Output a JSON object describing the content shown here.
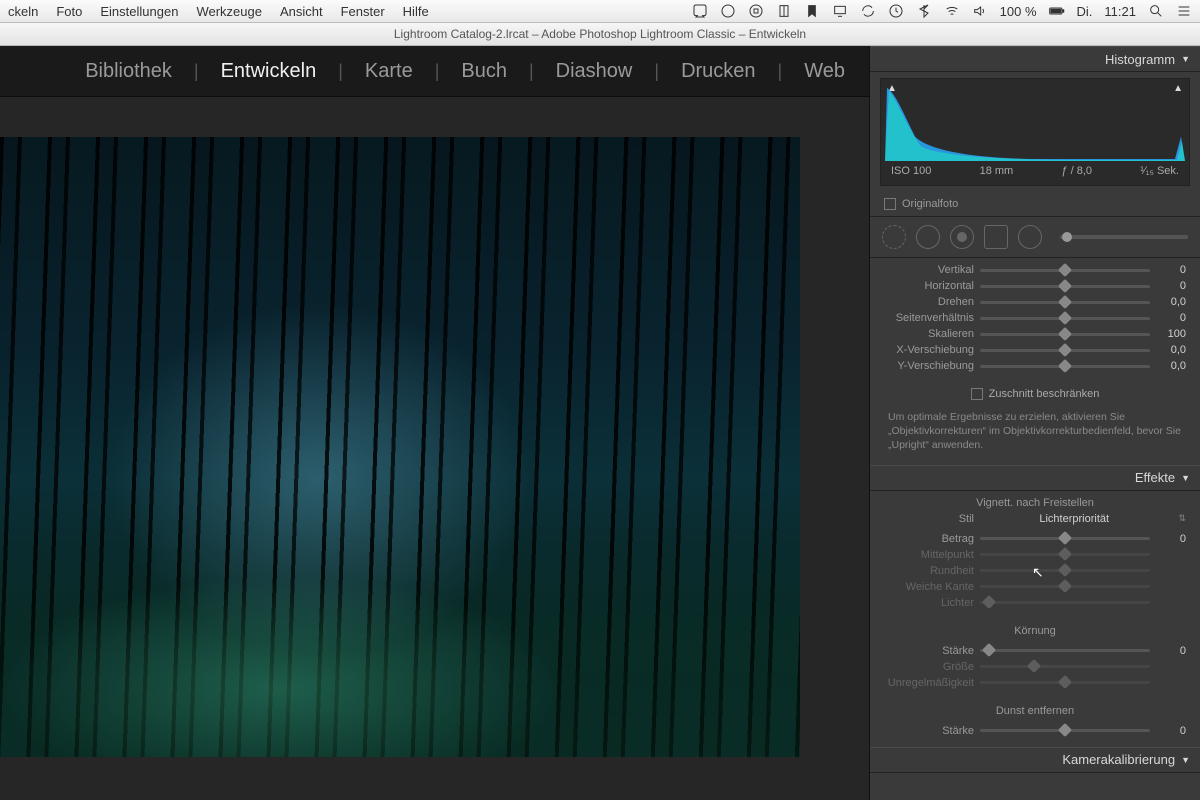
{
  "mac_menu": [
    "ckeln",
    "Foto",
    "Einstellungen",
    "Werkzeuge",
    "Ansicht",
    "Fenster",
    "Hilfe"
  ],
  "mac_status": {
    "battery": "100 %",
    "day": "Di.",
    "time": "11:21"
  },
  "window_title": "Lightroom Catalog-2.lrcat – Adobe Photoshop Lightroom Classic – Entwickeln",
  "modules": [
    "Bibliothek",
    "Entwickeln",
    "Karte",
    "Buch",
    "Diashow",
    "Drucken",
    "Web"
  ],
  "active_module": "Entwickeln",
  "histogram": {
    "title": "Histogramm",
    "iso": "ISO 100",
    "focal": "18 mm",
    "aperture": "ƒ / 8,0",
    "shutter": "¹⁄₁₅ Sek.",
    "original": "Originalfoto"
  },
  "transform": {
    "rows": [
      {
        "label": "Vertikal",
        "value": "0",
        "pos": 50
      },
      {
        "label": "Horizontal",
        "value": "0",
        "pos": 50
      },
      {
        "label": "Drehen",
        "value": "0,0",
        "pos": 50
      },
      {
        "label": "Seitenverhältnis",
        "value": "0",
        "pos": 50
      },
      {
        "label": "Skalieren",
        "value": "100",
        "pos": 50
      },
      {
        "label": "X-Verschiebung",
        "value": "0,0",
        "pos": 50
      },
      {
        "label": "Y-Verschiebung",
        "value": "0,0",
        "pos": 50
      }
    ],
    "constrain": "Zuschnitt beschränken",
    "info": "Um optimale Ergebnisse zu erzielen, aktivieren Sie „Objektivkorrekturen“ im Objektivkorrekturbedienfeld, bevor Sie „Upright“ anwenden."
  },
  "effects": {
    "title": "Effekte",
    "vignette_hd": "Vignett. nach Freistellen",
    "style_label": "Stil",
    "style_value": "Lichterpriorität",
    "vrows": [
      {
        "label": "Betrag",
        "value": "0",
        "pos": 50,
        "dim": false
      },
      {
        "label": "Mittelpunkt",
        "value": "",
        "pos": 50,
        "dim": true
      },
      {
        "label": "Rundheit",
        "value": "",
        "pos": 50,
        "dim": true
      },
      {
        "label": "Weiche Kante",
        "value": "",
        "pos": 50,
        "dim": true
      },
      {
        "label": "Lichter",
        "value": "",
        "pos": 5,
        "dim": true
      }
    ],
    "grain_hd": "Körnung",
    "grows": [
      {
        "label": "Stärke",
        "value": "0",
        "pos": 5,
        "dim": false
      },
      {
        "label": "Größe",
        "value": "",
        "pos": 32,
        "dim": true
      },
      {
        "label": "Unregelmäßigkeit",
        "value": "",
        "pos": 50,
        "dim": true
      }
    ],
    "dehaze_hd": "Dunst entfernen",
    "dehaze": {
      "label": "Stärke",
      "value": "0",
      "pos": 50
    }
  },
  "calib": {
    "title": "Kamerakalibrierung"
  }
}
